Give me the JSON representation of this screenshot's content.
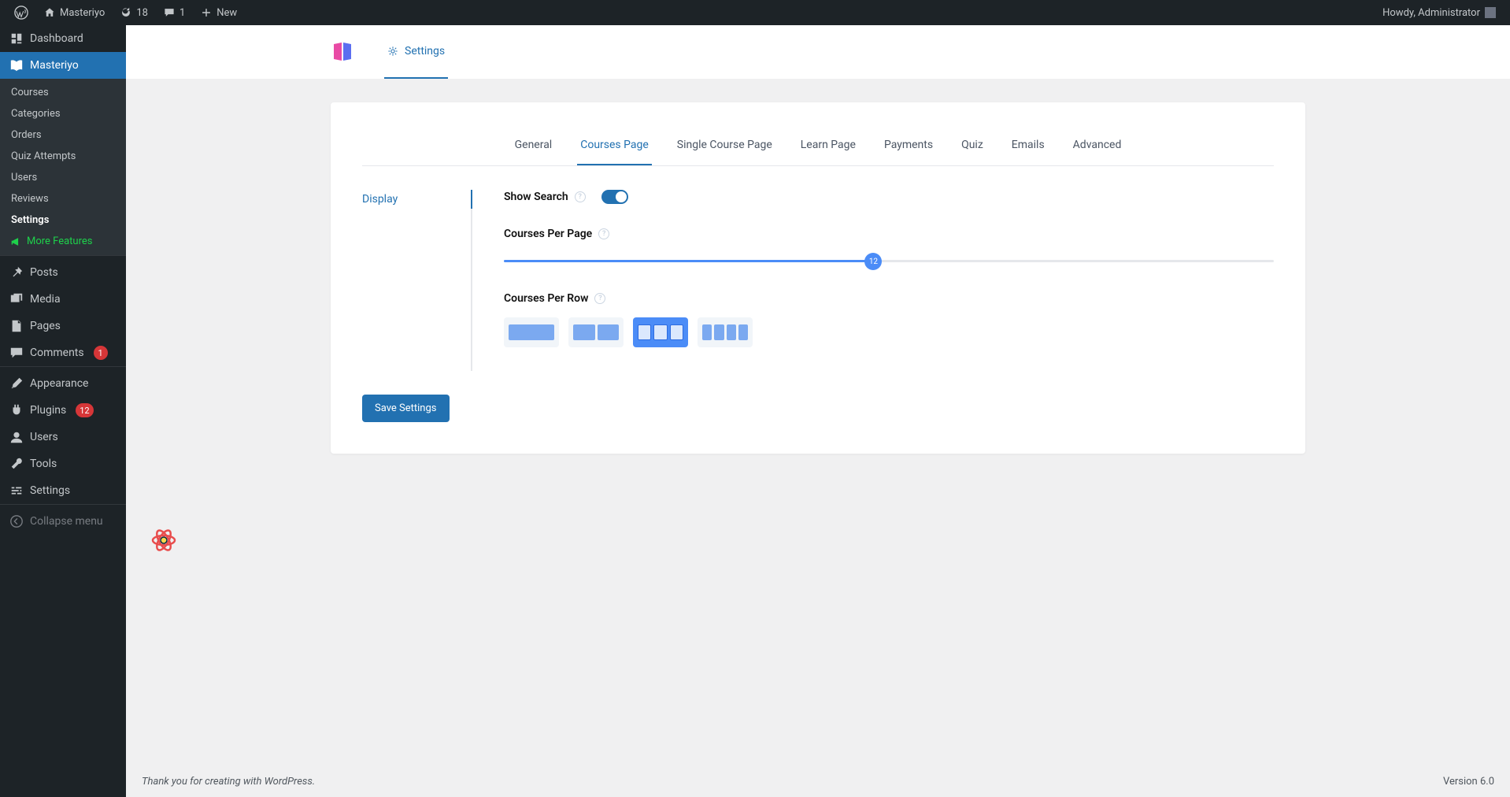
{
  "adminbar": {
    "site": "Masteriyo",
    "updates": "18",
    "comments": "1",
    "new": "New",
    "howdy": "Howdy, Administrator"
  },
  "sidebar": {
    "dashboard": "Dashboard",
    "masteriyo": "Masteriyo",
    "sub": {
      "courses": "Courses",
      "categories": "Categories",
      "orders": "Orders",
      "quiz_attempts": "Quiz Attempts",
      "users": "Users",
      "reviews": "Reviews",
      "settings": "Settings",
      "more": "More Features"
    },
    "posts": "Posts",
    "media": "Media",
    "pages": "Pages",
    "comments": "Comments",
    "comments_badge": "1",
    "appearance": "Appearance",
    "plugins": "Plugins",
    "plugins_badge": "12",
    "users2": "Users",
    "tools": "Tools",
    "settings2": "Settings",
    "collapse": "Collapse menu"
  },
  "header": {
    "tab": "Settings"
  },
  "tabs": {
    "general": "General",
    "courses_page": "Courses Page",
    "single_course": "Single Course Page",
    "learn": "Learn Page",
    "payments": "Payments",
    "quiz": "Quiz",
    "emails": "Emails",
    "advanced": "Advanced"
  },
  "side_tab": {
    "display": "Display"
  },
  "fields": {
    "show_search": "Show Search",
    "courses_per_page": "Courses Per Page",
    "courses_per_page_value": "12",
    "courses_per_row": "Courses Per Row"
  },
  "buttons": {
    "save": "Save Settings"
  },
  "footer": {
    "thanks": "Thank you for creating with WordPress.",
    "version": "Version 6.0"
  }
}
